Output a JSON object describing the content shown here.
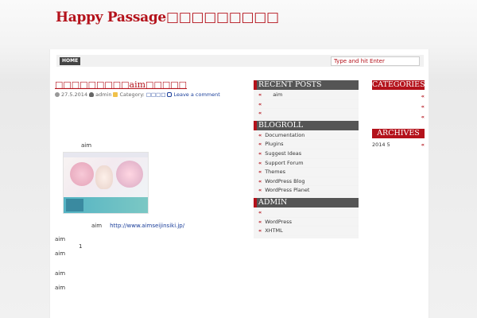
{
  "header": {
    "site_title": "Happy Passage□□□□□□□□□"
  },
  "nav": {
    "home_label": "HOME",
    "search_placeholder": "Type and hit Enter"
  },
  "post": {
    "title": "□□□□□□□□□aim□□□□□",
    "meta": {
      "date": "27.5.2014",
      "author": "admin",
      "category_label": "Category:",
      "category": "□□□□",
      "comments": "Leave a comment"
    },
    "lines": [
      "aim",
      "aim",
      "http://www.aimseijinsiki.jp/",
      "aim",
      "1",
      "aim",
      "aim",
      "aim"
    ]
  },
  "sidebar": {
    "recent_posts": {
      "title": "RECENT POSTS",
      "items": [
        "aim",
        "",
        ""
      ]
    },
    "blogroll": {
      "title": "BLOGROLL",
      "items": [
        "Documentation",
        "Plugins",
        "Suggest Ideas",
        "Support Forum",
        "Themes",
        "WordPress Blog",
        "WordPress Planet"
      ]
    },
    "admin": {
      "title": "ADMIN",
      "items": [
        "",
        "WordPress",
        "XHTML"
      ]
    },
    "categories": {
      "title": "CATEGORIES",
      "items": [
        "",
        "",
        ""
      ]
    },
    "archives": {
      "title": "ARCHIVES",
      "items": [
        "2014 5"
      ]
    },
    "bullet": "«"
  },
  "colors": {
    "accent": "#b4121b",
    "widget_dark": "#555555",
    "link": "#1a3e9a"
  },
  "icons": {
    "date": "clock-icon",
    "author": "user-icon",
    "category": "folder-icon",
    "comments": "comment-icon"
  }
}
